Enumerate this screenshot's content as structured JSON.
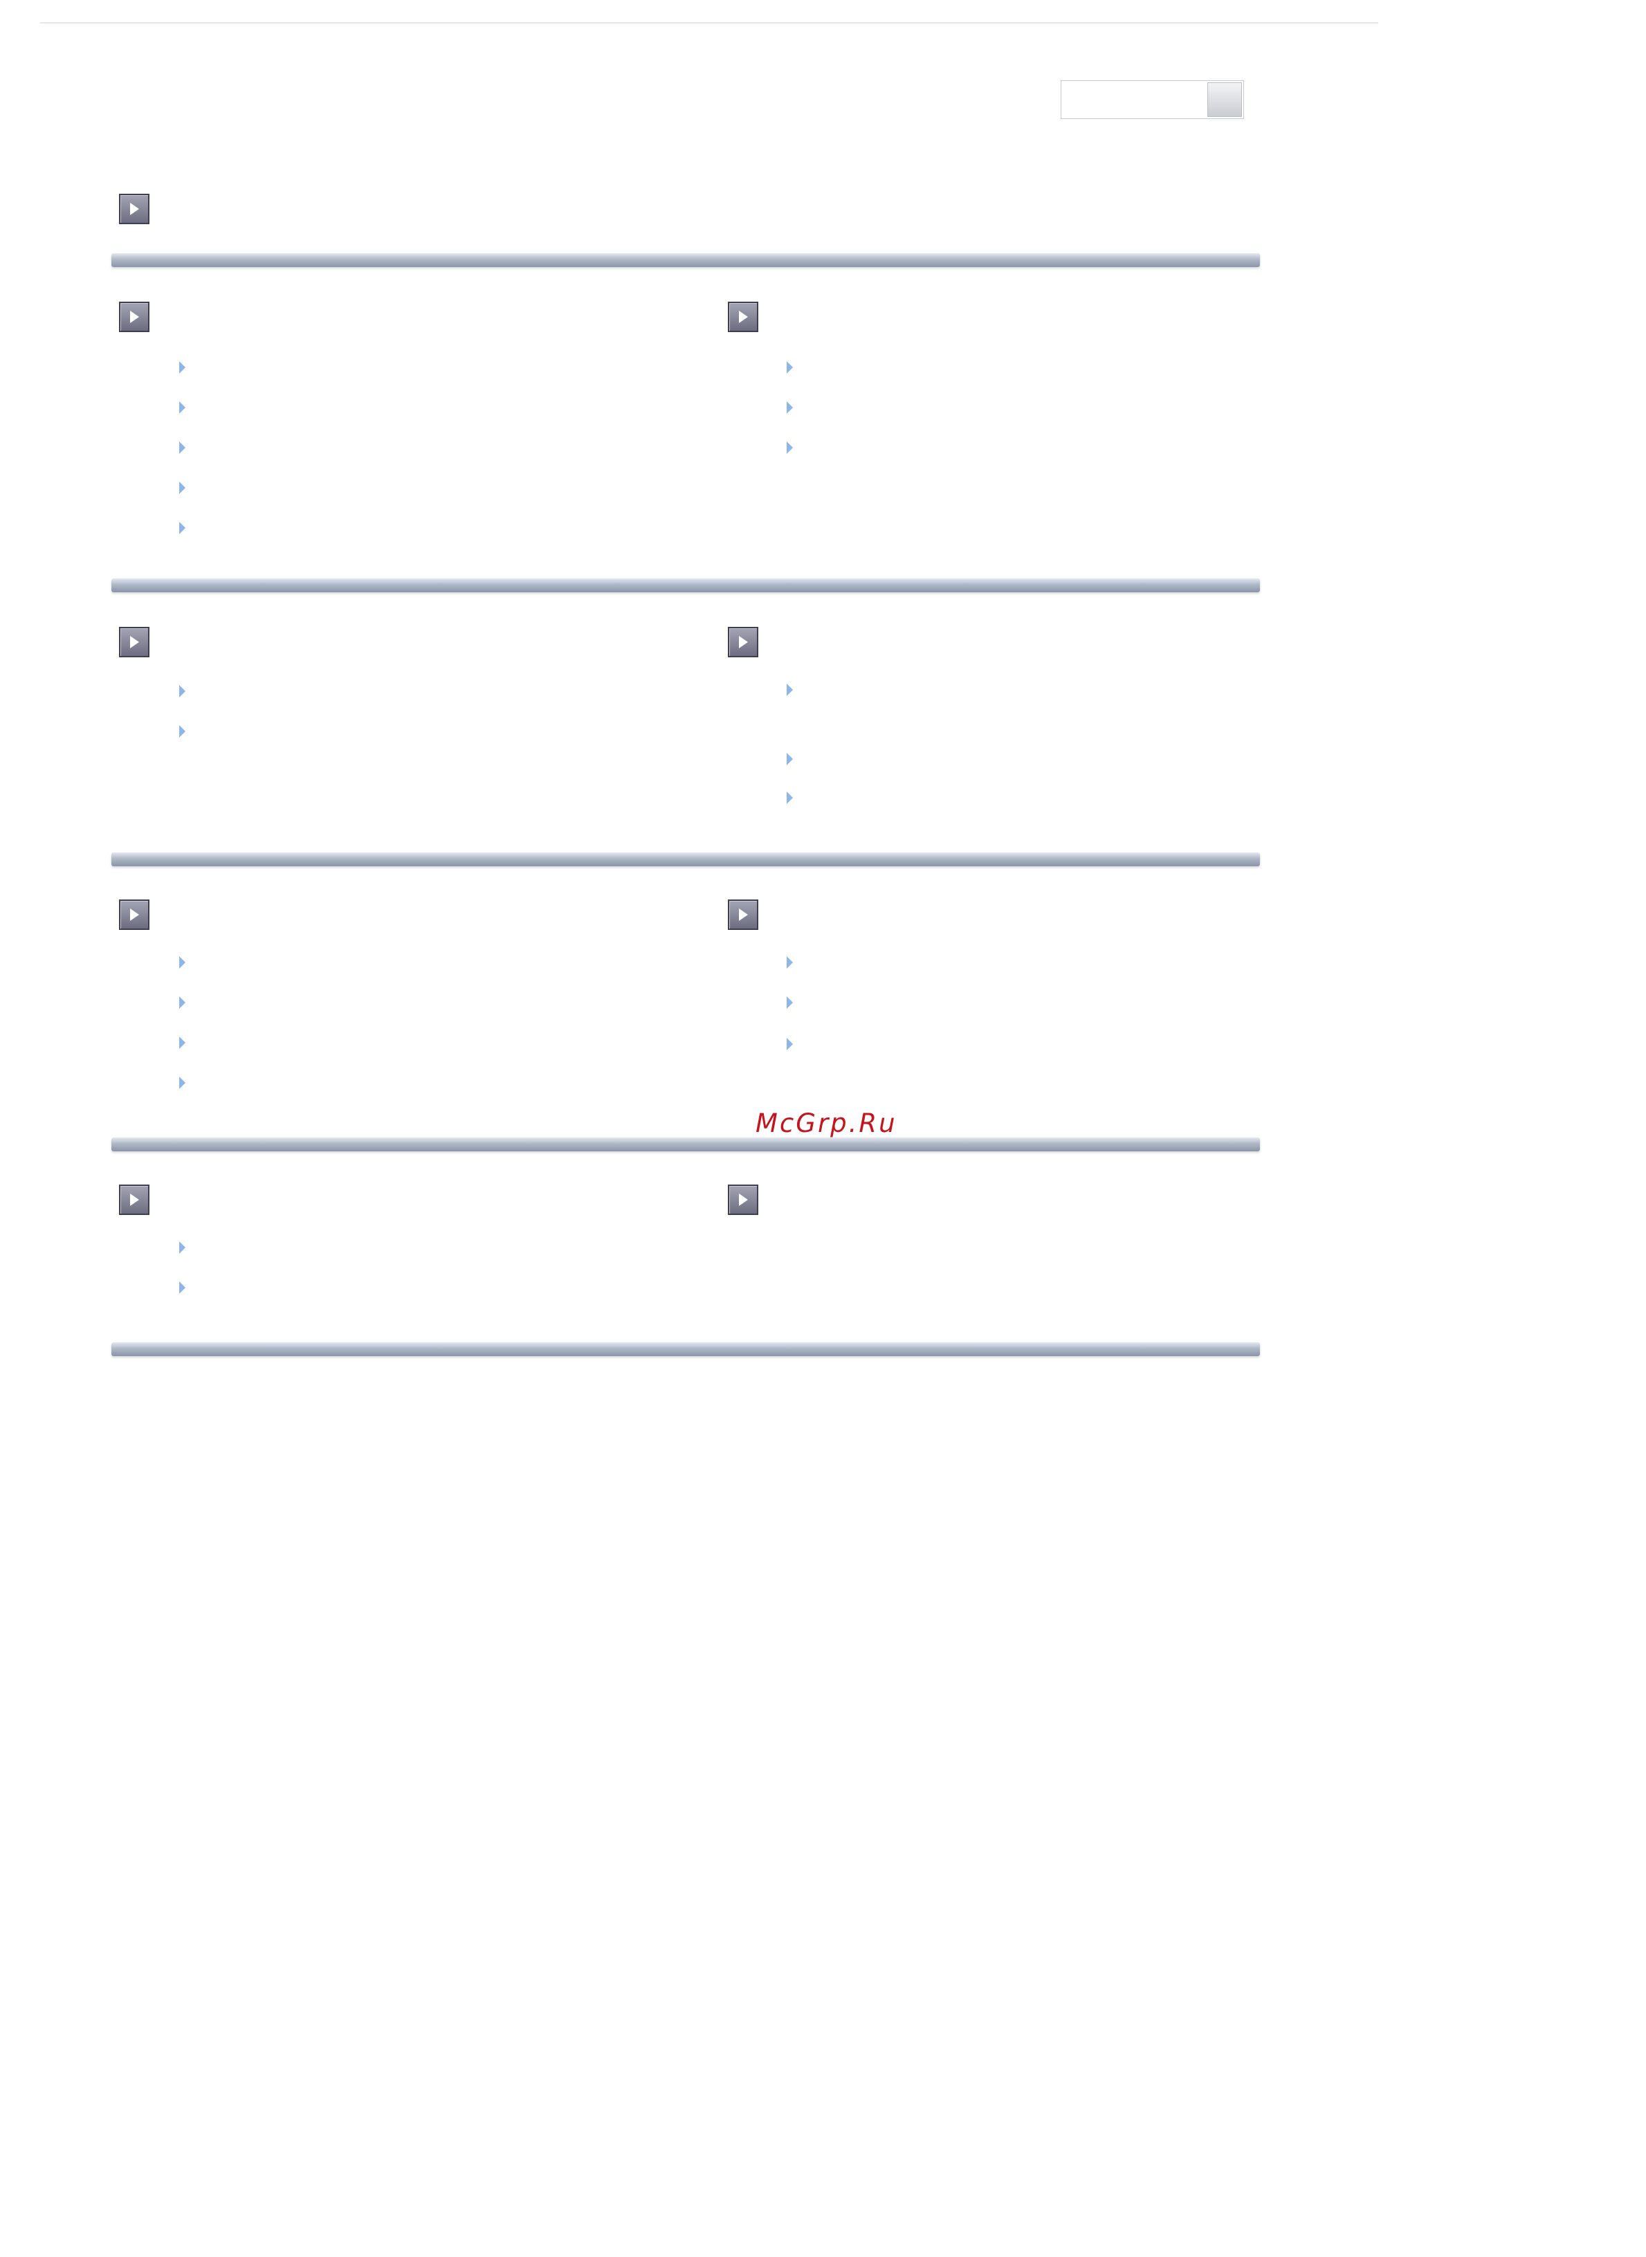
{
  "header": {
    "search": {
      "value": "",
      "placeholder": ""
    },
    "search_button_icon": "search-button-icon"
  },
  "icons": {
    "section_toggle": "right-arrow-box-icon",
    "list_bullet": "small-right-triangle-icon"
  },
  "colors": {
    "arrow_box": "#6c6d80",
    "bullet": "#8db6ea",
    "divider": "#aeb7c6",
    "watermark": "#c4141c"
  },
  "watermark": "McGrp.Ru"
}
